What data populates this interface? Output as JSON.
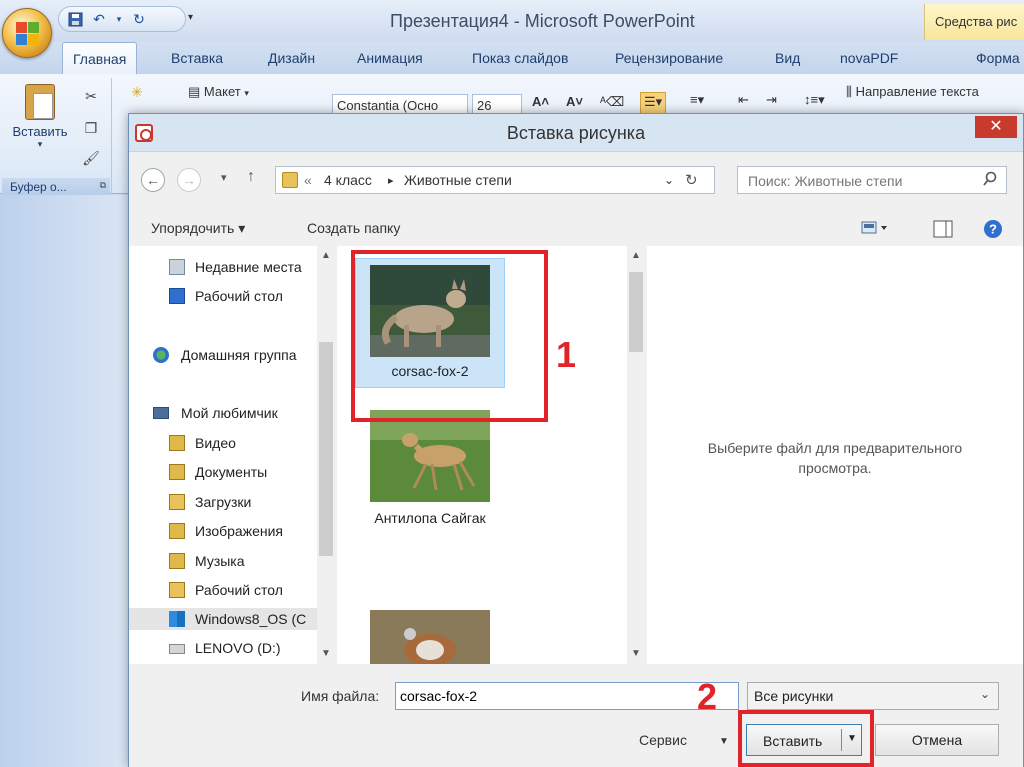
{
  "app": {
    "window_title": "Презентация4 - Microsoft PowerPoint",
    "context_tab": "Средства рис",
    "ribbon_tabs": [
      "Главная",
      "Вставка",
      "Дизайн",
      "Анимация",
      "Показ слайдов",
      "Рецензирование",
      "Вид",
      "novaPDF",
      "Форма"
    ],
    "active_tab": "Главная",
    "clipboard": {
      "paste_label": "Вставить",
      "group_label": "Буфер о..."
    },
    "layout_label": "Макет",
    "font_name": "Constantia (Осно",
    "font_size": "26",
    "text_direction": "Направление текста"
  },
  "dialog": {
    "title": "Вставка рисунка",
    "breadcrumb": [
      "«",
      "4 класс",
      "▸",
      "Животные степи"
    ],
    "search_placeholder": "Поиск: Животные степи",
    "toolbar": {
      "organize": "Упорядочить ▾",
      "new_folder": "Создать папку"
    },
    "nav_items": [
      {
        "label": "Недавние места",
        "icon": "recent-places-icon"
      },
      {
        "label": "Рабочий стол",
        "icon": "desktop-icon"
      },
      {
        "label": "Домашняя группа",
        "icon": "homegroup-icon"
      },
      {
        "label": "Мой любимчик",
        "icon": "computer-icon"
      },
      {
        "label": "Видео",
        "icon": "video-library-icon"
      },
      {
        "label": "Документы",
        "icon": "documents-library-icon"
      },
      {
        "label": "Загрузки",
        "icon": "downloads-folder-icon"
      },
      {
        "label": "Изображения",
        "icon": "pictures-library-icon"
      },
      {
        "label": "Музыка",
        "icon": "music-library-icon"
      },
      {
        "label": "Рабочий стол",
        "icon": "desktop-folder-icon"
      },
      {
        "label": "Windows8_OS (C",
        "icon": "windows-drive-icon"
      },
      {
        "label": "LENOVO (D:)",
        "icon": "drive-icon"
      }
    ],
    "files": [
      {
        "name": "corsac-fox-2",
        "selected": true
      },
      {
        "name": "Антилопа Сайгак",
        "selected": false
      },
      {
        "name": "",
        "selected": false
      }
    ],
    "preview_text": "Выберите файл для предварительного просмотра.",
    "filename_label": "Имя файла:",
    "filename_value": "corsac-fox-2",
    "filetype_value": "Все рисунки",
    "service_label": "Сервис",
    "insert_label": "Вставить",
    "cancel_label": "Отмена"
  },
  "annotations": {
    "step1": "1",
    "step2": "2"
  },
  "colors": {
    "annotation_red": "#e0242a",
    "selection_blue": "#cce4f7",
    "dialog_title_bg": "#d7e4f2"
  }
}
